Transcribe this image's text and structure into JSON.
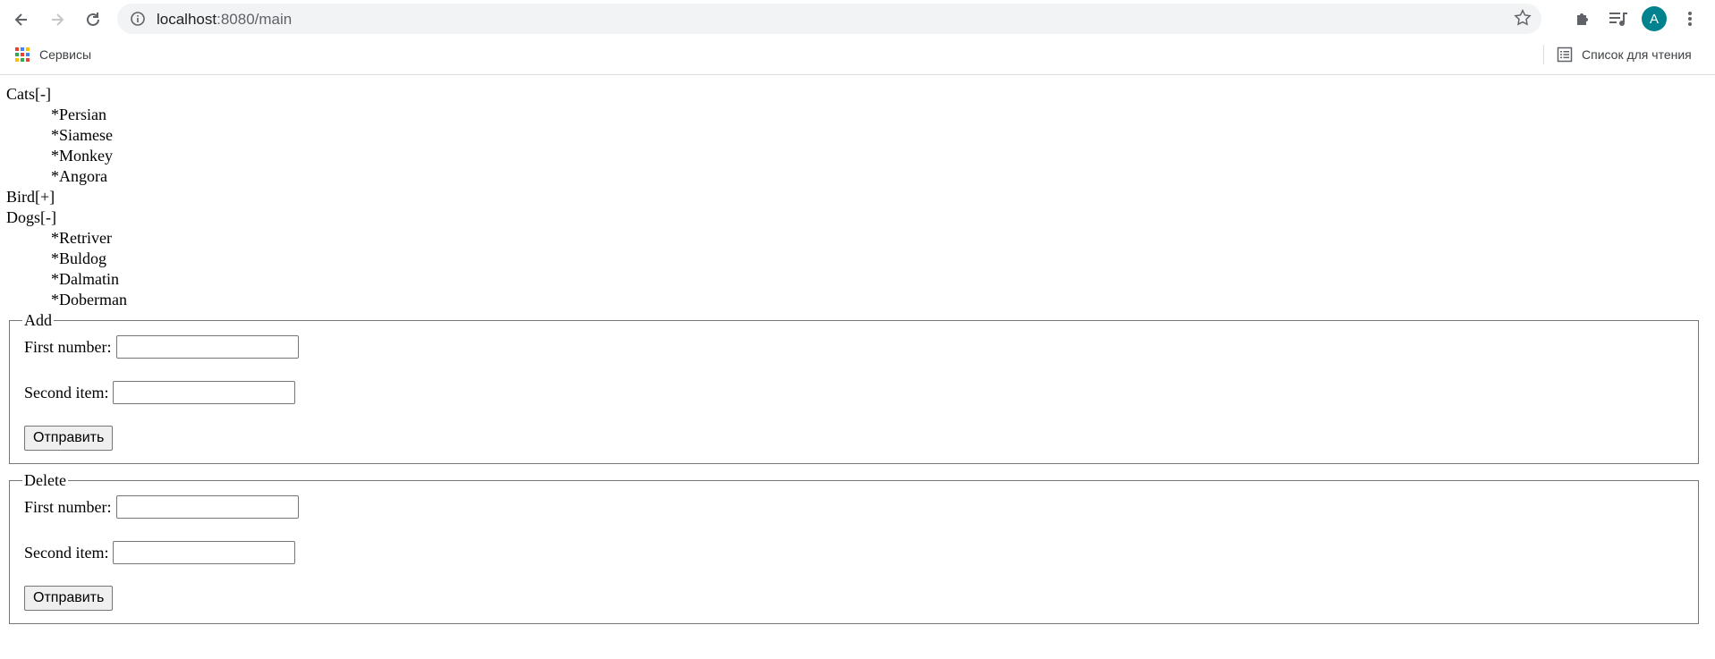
{
  "browser": {
    "url_host": "localhost",
    "url_rest": ":8080/main",
    "profile_initial": "A",
    "bookmarks": {
      "apps_label": "Сервисы",
      "reading_list_label": "Список для чтения"
    }
  },
  "tree": [
    {
      "title": "Cats",
      "toggle": "[-]",
      "items": [
        "*Persian",
        "*Siamese",
        "*Monkey",
        "*Angora"
      ]
    },
    {
      "title": "Bird",
      "toggle": "[+]",
      "items": []
    },
    {
      "title": "Dogs",
      "toggle": "[-]",
      "items": [
        "*Retriver",
        "*Buldog",
        "*Dalmatin",
        "*Doberman"
      ]
    }
  ],
  "forms": {
    "add": {
      "legend": "Add",
      "first_label": "First number:",
      "first_value": "",
      "second_label": "Second item:",
      "second_value": "",
      "submit_label": "Отправить"
    },
    "delete": {
      "legend": "Delete",
      "first_label": "First number:",
      "first_value": "",
      "second_label": "Second item:",
      "second_value": "",
      "submit_label": "Отправить"
    }
  },
  "colors": {
    "avatar": "#00838f",
    "omnibox_bg": "#f1f3f4"
  }
}
